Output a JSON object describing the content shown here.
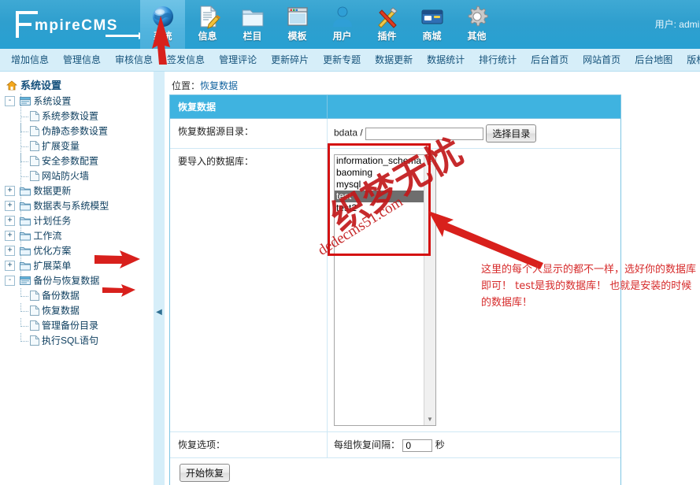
{
  "header": {
    "logo_text": "EmpireCMS",
    "user_label": "用户: admin",
    "tabs": [
      {
        "label": "系统",
        "icon": "globe-icon",
        "active": true
      },
      {
        "label": "信息",
        "icon": "document-pencil-icon",
        "active": false
      },
      {
        "label": "栏目",
        "icon": "folder-icon",
        "active": false
      },
      {
        "label": "模板",
        "icon": "window-icon",
        "active": false
      },
      {
        "label": "用户",
        "icon": "user-icon",
        "active": false
      },
      {
        "label": "插件",
        "icon": "tools-icon",
        "active": false
      },
      {
        "label": "商城",
        "icon": "card-icon",
        "active": false
      },
      {
        "label": "其他",
        "icon": "gear-icon",
        "active": false
      }
    ]
  },
  "nav": {
    "items": [
      "增加信息",
      "管理信息",
      "审核信息",
      "签发信息",
      "管理评论",
      "更新碎片",
      "更新专题",
      "数据更新",
      "数据统计",
      "排行统计",
      "后台首页",
      "网站首页",
      "后台地图",
      "版权"
    ]
  },
  "sidebar": {
    "title": "系统设置",
    "nodes": [
      {
        "level": 1,
        "toggle": "-",
        "icon": "tree-node-icon",
        "label": "系统设置"
      },
      {
        "level": 2,
        "toggle": "",
        "icon": "page-icon",
        "label": "系统参数设置"
      },
      {
        "level": 2,
        "toggle": "",
        "icon": "page-icon",
        "label": "伪静态参数设置"
      },
      {
        "level": 2,
        "toggle": "",
        "icon": "page-icon",
        "label": "扩展变量"
      },
      {
        "level": 2,
        "toggle": "",
        "icon": "page-icon",
        "label": "安全参数配置"
      },
      {
        "level": 2,
        "toggle": "",
        "icon": "page-icon",
        "label": "网站防火墙"
      },
      {
        "level": 1,
        "toggle": "+",
        "icon": "folder-icon",
        "label": "数据更新"
      },
      {
        "level": 1,
        "toggle": "+",
        "icon": "folder-icon",
        "label": "数据表与系统模型"
      },
      {
        "level": 1,
        "toggle": "+",
        "icon": "folder-icon",
        "label": "计划任务"
      },
      {
        "level": 1,
        "toggle": "+",
        "icon": "folder-icon",
        "label": "工作流"
      },
      {
        "level": 1,
        "toggle": "+",
        "icon": "folder-icon",
        "label": "优化方案"
      },
      {
        "level": 1,
        "toggle": "+",
        "icon": "folder-icon",
        "label": "扩展菜单"
      },
      {
        "level": 1,
        "toggle": "-",
        "icon": "tree-node-icon",
        "label": "备份与恢复数据"
      },
      {
        "level": 2,
        "toggle": "",
        "icon": "page-icon",
        "label": "备份数据"
      },
      {
        "level": 2,
        "toggle": "",
        "icon": "page-icon",
        "label": "恢复数据"
      },
      {
        "level": 2,
        "toggle": "",
        "icon": "page-icon",
        "label": "管理备份目录"
      },
      {
        "level": 2,
        "toggle": "",
        "icon": "page-icon",
        "label": "执行SQL语句"
      }
    ]
  },
  "main": {
    "breadcrumb_prefix": "位置：",
    "breadcrumb_current": "恢复数据",
    "panel_title": "恢复数据",
    "rows": {
      "source_dir_label": "恢复数据源目录：",
      "source_dir_prefix": "bdata /",
      "source_dir_value": "",
      "source_dir_placeholder": "",
      "choose_dir_button": "选择目录",
      "import_db_label": "要导入的数据库：",
      "restore_options_label": "恢复选项：",
      "interval_label": "每组恢复间隔：",
      "interval_value": "0",
      "interval_unit": "秒",
      "start_button": "开始恢复"
    },
    "databases": [
      {
        "name": "information_schema",
        "selected": false
      },
      {
        "name": "baoming",
        "selected": false
      },
      {
        "name": "mysql",
        "selected": false
      },
      {
        "name": "test",
        "selected": true
      },
      {
        "name": "test2",
        "selected": false
      }
    ]
  },
  "annotation": {
    "text": "这里的每个人显示的都不一样，选好你的数据库即可！ test是我的数据库！ 也就是安装的时候的数据库！",
    "color": "#d62b2b"
  },
  "watermark": {
    "cn": "织梦无忧",
    "en": "dedecms51.com"
  },
  "colors": {
    "topbar": "#2f9fce",
    "nav": "#d6eef9",
    "panel_header": "#3fb3e0",
    "panel_border": "#7ec5e3",
    "annotation_red": "#d41212"
  }
}
